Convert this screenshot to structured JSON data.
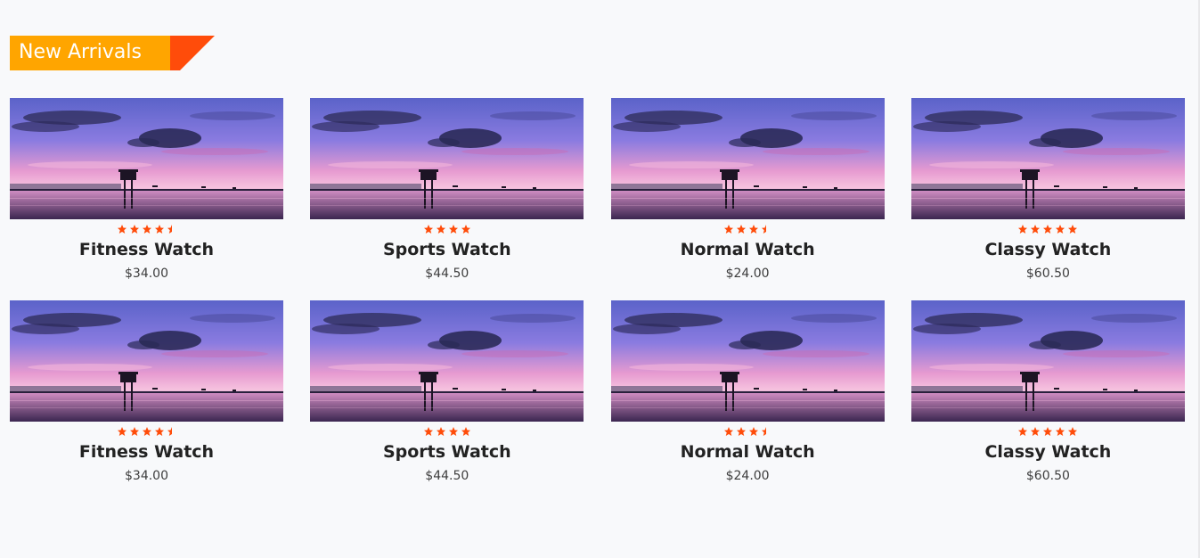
{
  "section": {
    "title": "New Arrivals",
    "colors": {
      "banner": "#ffa500",
      "flag": "#ff4c0a"
    }
  },
  "products": [
    {
      "name": "Fitness Watch",
      "price": "$34.00",
      "rating": 4.5,
      "image_icon": "sunset-seascape-image"
    },
    {
      "name": "Sports Watch",
      "price": "$44.50",
      "rating": 4,
      "image_icon": "sunset-seascape-image"
    },
    {
      "name": "Normal Watch",
      "price": "$24.00",
      "rating": 3.5,
      "image_icon": "sunset-seascape-image"
    },
    {
      "name": "Classy Watch",
      "price": "$60.50",
      "rating": 5,
      "image_icon": "sunset-seascape-image"
    },
    {
      "name": "Fitness Watch",
      "price": "$34.00",
      "rating": 4.5,
      "image_icon": "sunset-seascape-image"
    },
    {
      "name": "Sports Watch",
      "price": "$44.50",
      "rating": 4,
      "image_icon": "sunset-seascape-image"
    },
    {
      "name": "Normal Watch",
      "price": "$24.00",
      "rating": 3.5,
      "image_icon": "sunset-seascape-image"
    },
    {
      "name": "Classy Watch",
      "price": "$60.50",
      "rating": 5,
      "image_icon": "sunset-seascape-image"
    }
  ],
  "star_color": "#ff4c0a"
}
